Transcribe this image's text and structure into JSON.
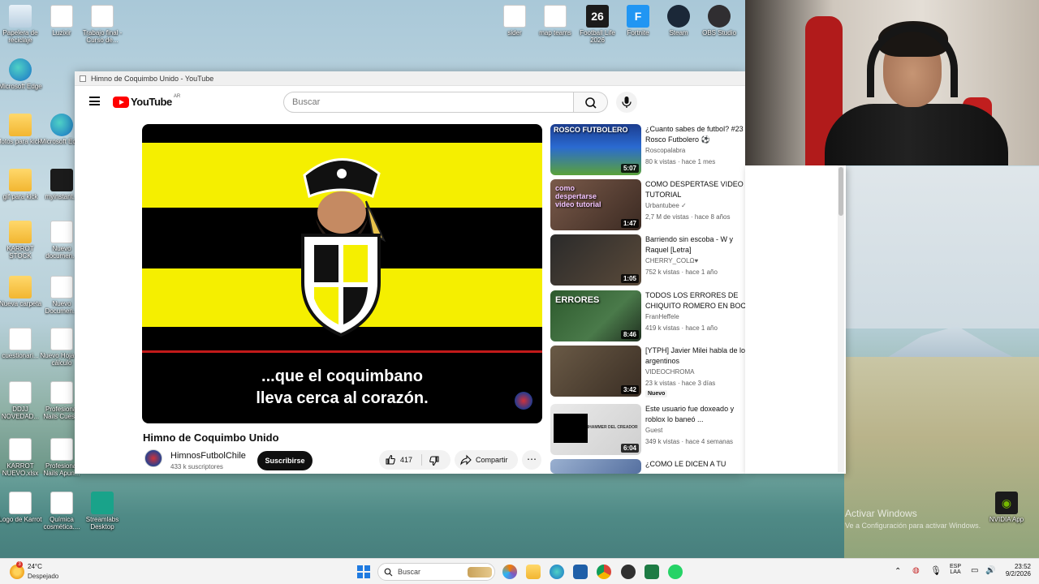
{
  "window": {
    "title": "Himno de Coquimbo Unido - YouTube"
  },
  "masthead": {
    "logo_text": "YouTube",
    "region": "AR",
    "search_placeholder": "Buscar"
  },
  "player": {
    "subtitle_line1": "...que el coquimbano",
    "subtitle_line2": "lleva cerca al corazón."
  },
  "video": {
    "title": "Himno de Coquimbo Unido",
    "channel": "HimnosFutbolChile",
    "subscribers": "433 k suscriptores",
    "subscribe_label": "Suscribirse",
    "likes": "417",
    "share_label": "Compartir"
  },
  "recommendations": [
    {
      "title": "¿Cuanto sabes de futbol? #23 Rosco Futbolero ⚽",
      "channel": "Roscopalabra",
      "meta": "80 k vistas · hace 1 mes",
      "duration": "5:07",
      "thumb_text": "ROSCO FUTBOLERO",
      "badge": ""
    },
    {
      "title": "COMO DESPERTASE VIDEO TUTORIAL",
      "channel": "Urbantubee ✓",
      "meta": "2,7 M de vistas · hace 8 años",
      "duration": "1:47",
      "thumb_text": "como despertarse video tutorial",
      "badge": ""
    },
    {
      "title": "Barriendo sin escoba - W y Raquel [Letra]",
      "channel": "CHERRY_COLΩ♥",
      "meta": "752 k vistas · hace 1 año",
      "duration": "1:05",
      "thumb_text": "",
      "badge": ""
    },
    {
      "title": "TODOS LOS ERRORES DE CHIQUITO ROMERO EN BOCA ...",
      "channel": "FranHeffele",
      "meta": "419 k vistas · hace 1 año",
      "duration": "8:46",
      "thumb_text": "ERRORES",
      "badge": ""
    },
    {
      "title": "[YTPH] Javier Milei habla de los argentinos",
      "channel": "VIDEOCHROMA",
      "meta": "23 k vistas · hace 3 días",
      "duration": "3:42",
      "thumb_text": "",
      "badge": "Nuevo"
    },
    {
      "title": "Este usuario fue doxeado y roblox lo baneó ...",
      "channel": "Guest",
      "meta": "349 k vistas · hace 4 semanas",
      "duration": "6:04",
      "thumb_text": "LLEGO EL BANHAMMER DEL CREADOR",
      "badge": ""
    },
    {
      "title": "¿COMO LE DICEN A TU",
      "channel": "",
      "meta": "",
      "duration": "",
      "thumb_text": "",
      "badge": ""
    }
  ],
  "desktop_icons": [
    {
      "label": "Papelera de reciclaje",
      "icon": "recycle-bin-icon"
    },
    {
      "label": "Luzixir",
      "icon": "document-icon"
    },
    {
      "label": "Trabajo final -Curso de...",
      "icon": "document-icon"
    },
    {
      "label": "Microsoft Edge",
      "icon": "edge-icon"
    },
    {
      "label": "fotos para kick",
      "icon": "folder-icon"
    },
    {
      "label": "Microsoft Edge",
      "icon": "edge-icon"
    },
    {
      "label": "gif para kick",
      "icon": "folder-icon"
    },
    {
      "label": "myinstant...",
      "icon": "media-icon"
    },
    {
      "label": "KARROT STOCK",
      "icon": "folder-icon"
    },
    {
      "label": "Nuevo documen...",
      "icon": "document-icon"
    },
    {
      "label": "Nueva carpeta",
      "icon": "folder-icon"
    },
    {
      "label": "Nuevo Documen...",
      "icon": "document-icon"
    },
    {
      "label": "cuestionari...",
      "icon": "document-icon"
    },
    {
      "label": "Nuevo Hoja de cálculo",
      "icon": "spreadsheet-icon"
    },
    {
      "label": "DDJJ NOVEDAD...",
      "icon": "pdf-icon"
    },
    {
      "label": "Profesional Nails Cues...",
      "icon": "pdf-icon"
    },
    {
      "label": "KARROT NUEVO.xlsx",
      "icon": "document-icon"
    },
    {
      "label": "Profesional Nails Apun...",
      "icon": "document-icon"
    },
    {
      "label": "Logo de Karrot",
      "icon": "image-icon"
    },
    {
      "label": "Química cosmética....",
      "icon": "document-icon"
    },
    {
      "label": "Streamlabs Desktop",
      "icon": "streamlabs-icon"
    }
  ],
  "top_icons": [
    {
      "label": "sider",
      "icon": "document-icon"
    },
    {
      "label": "map teams",
      "icon": "document-icon"
    },
    {
      "label": "Football Life 2026",
      "icon": "game-icon",
      "glyph": "26"
    },
    {
      "label": "Fortnite",
      "icon": "fortnite-icon",
      "glyph": "F"
    },
    {
      "label": "Steam",
      "icon": "steam-icon"
    },
    {
      "label": "OBS Studio",
      "icon": "obs-icon"
    }
  ],
  "overlay": {
    "activate_title": "Activar Windows",
    "activate_sub": "Ve a Configuración para activar Windows.",
    "nvidia_label": "NVIDIA App"
  },
  "taskbar": {
    "temperature": "24°C",
    "weather": "Despejado",
    "weather_badge": "3",
    "search_label": "Buscar",
    "lang_line1": "ESP",
    "lang_line2": "LAA",
    "time": "23:52",
    "date": "9/2/2026"
  }
}
